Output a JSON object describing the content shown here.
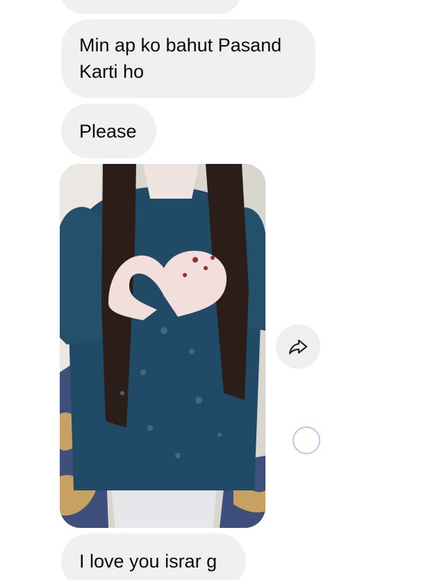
{
  "thread": {
    "messages": [
      {
        "kind": "text",
        "text": ""
      },
      {
        "kind": "text",
        "text": "Min ap ko bahut Pasand\nKarti ho"
      },
      {
        "kind": "text",
        "text": "Please"
      },
      {
        "kind": "image",
        "icon": "heart-hands-photo"
      },
      {
        "kind": "text",
        "text": "I love you israr g"
      }
    ]
  },
  "actions": {
    "share_icon": "share-arrow-icon",
    "select_icon": "select-circle-icon"
  },
  "colors": {
    "bubble_bg": "#f0f0f0",
    "text": "#0a0a0a",
    "select_ring": "#b9c6ec"
  }
}
